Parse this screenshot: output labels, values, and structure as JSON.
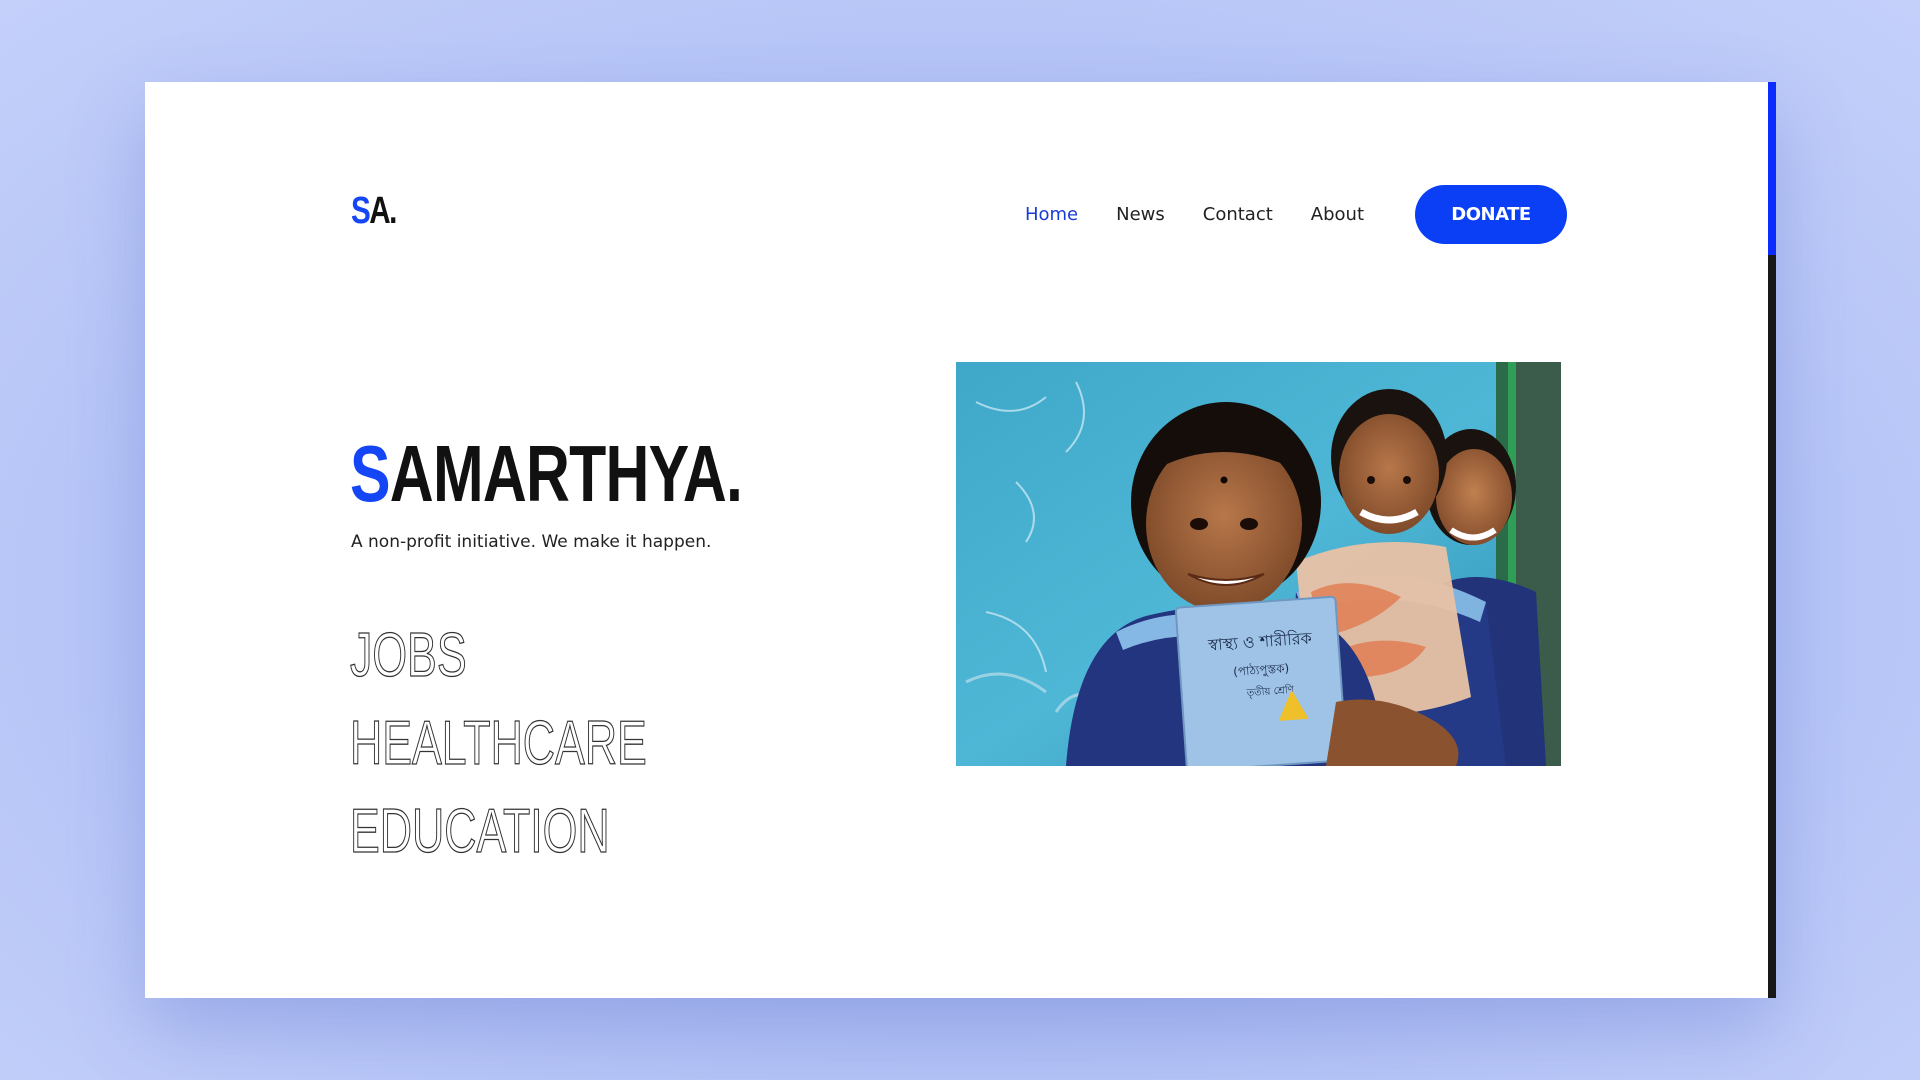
{
  "brand": {
    "logo_accent": "S",
    "logo_rest": "A.",
    "title_accent": "S",
    "title_rest": "AMARTHYA.",
    "tagline": "A non-profit initiative. We make it happen.",
    "accent_color": "#1446f5"
  },
  "nav": {
    "items": [
      {
        "label": "Home",
        "active": true
      },
      {
        "label": "News",
        "active": false
      },
      {
        "label": "Contact",
        "active": false
      },
      {
        "label": "About",
        "active": false
      }
    ],
    "donate_label": "DONATE"
  },
  "focus_areas": [
    "JOBS",
    "HEALTHCARE",
    "EDUCATION"
  ],
  "hero_image": {
    "book_text_1": "স্বাস্থ্য ও শারীরিক",
    "book_text_2": "(পাঠ্যপুস্তক)",
    "book_text_3": "তৃতীয় শ্রেণি"
  }
}
